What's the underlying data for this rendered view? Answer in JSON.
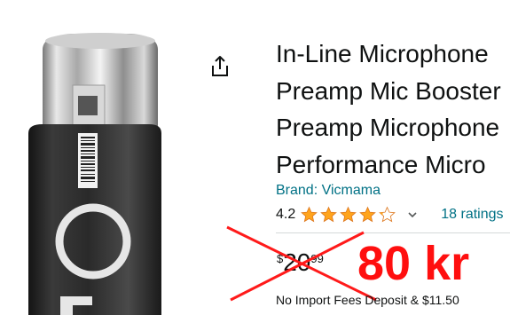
{
  "product": {
    "title_lines": [
      "In-Line Microphone",
      "Preamp Mic Booster",
      "Preamp Microphone",
      "Performance Micro"
    ],
    "brand_link": "Brand: Vicmama",
    "rating": {
      "value_text": "4.2",
      "stars": 4.2,
      "max_stars": 5,
      "count_link": "18 ratings"
    },
    "price": {
      "symbol": "$",
      "whole": "20",
      "fraction": "99"
    },
    "overlay_price": "80 kr",
    "import_fees": "No Import Fees Deposit & $11.50"
  },
  "icons": {
    "share": "share-icon",
    "star": "star-icon",
    "chevron": "chevron-down-icon"
  },
  "colors": {
    "text": "#0f1111",
    "link": "#007185",
    "star": "#ffa41c",
    "overlay_red": "#ff0f0f",
    "strike_red": "#ff1a1a"
  }
}
